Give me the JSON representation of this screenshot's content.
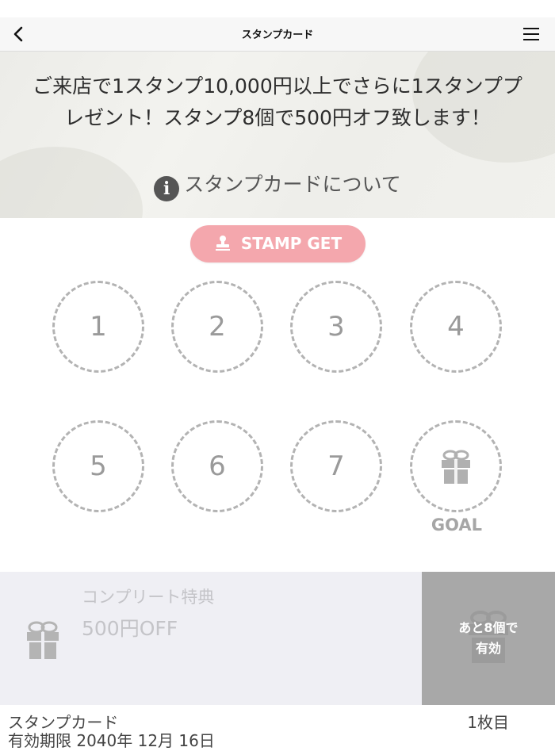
{
  "nav": {
    "title": "スタンプカード",
    "back_icon": "chevron-left-icon",
    "menu_icon": "hamburger-menu-icon"
  },
  "hero": {
    "message": "ご来店で1スタンプ10,000円以上でさらに1スタンププレゼント！スタンプ8個で500円オフ致します！",
    "about_link": "スタンプカードについて",
    "about_icon": "info-icon"
  },
  "stamp_button": {
    "label": "STAMP GET",
    "icon": "stamp-icon"
  },
  "slots": [
    {
      "label": "1"
    },
    {
      "label": "2"
    },
    {
      "label": "3"
    },
    {
      "label": "4"
    },
    {
      "label": "5"
    },
    {
      "label": "6"
    },
    {
      "label": "7"
    }
  ],
  "goal": {
    "label": "GOAL",
    "icon": "gift-icon"
  },
  "reward": {
    "title": "コンプリート特典",
    "value": "500円OFF",
    "icon": "gift-icon"
  },
  "remaining": {
    "line1": "あと8個で",
    "line2": "有効"
  },
  "footer": {
    "card_name": "スタンプカード",
    "card_count": "1枚目",
    "expiry": "有効期限 2040年 12月 16日"
  },
  "colors": {
    "accent_pink": "#f4a7ad",
    "slot_border": "#b3b3b3",
    "remaining_bg": "#a8a8a8",
    "reward_bg": "#efeff4"
  }
}
